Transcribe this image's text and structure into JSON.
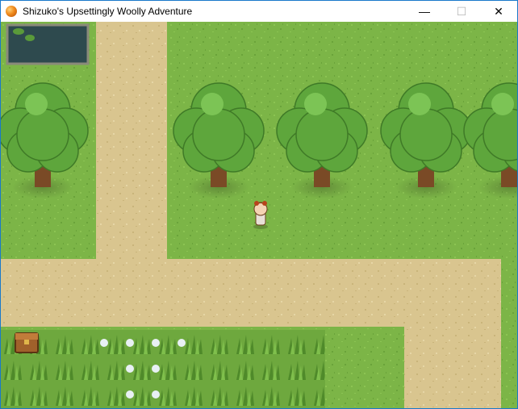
{
  "window": {
    "title": "Shizuko's Upsettingly Woolly Adventure",
    "controls": {
      "minimize": "—",
      "maximize": "☐",
      "close": "✕"
    }
  },
  "game": {
    "scene": "forest-clearing",
    "colors": {
      "grass": "#7cb547",
      "grass_dark": "#6aa33a",
      "path": "#d9c58f",
      "path_dark": "#c9b47a",
      "water": "#2e4a4e",
      "foliage": "#5ea63c",
      "trunk": "#7a4a26"
    }
  }
}
